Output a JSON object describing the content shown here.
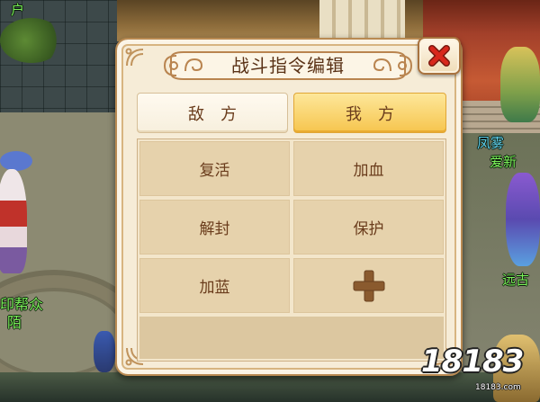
{
  "dialog": {
    "title": "战斗指令编辑",
    "close_icon": "close-icon",
    "tabs": [
      {
        "label": "敌方",
        "selected": false
      },
      {
        "label": "我方",
        "selected": true
      }
    ],
    "commands": [
      {
        "label": "复活"
      },
      {
        "label": "加血"
      },
      {
        "label": "解封"
      },
      {
        "label": "保护"
      },
      {
        "label": "加蓝"
      }
    ],
    "add_command_icon": "plus-icon"
  },
  "scene": {
    "name_tags": [
      {
        "text": "户",
        "color": "#7cf05a"
      },
      {
        "text": "印帮众",
        "color": "#7cf05a"
      },
      {
        "text": "陌",
        "color": "#7cf05a"
      },
      {
        "text": "凤雾",
        "color": "#5fd0ef"
      },
      {
        "text": "爱新",
        "color": "#7cf05a"
      },
      {
        "text": "远古",
        "color": "#7cf05a"
      }
    ]
  },
  "watermark": {
    "logo": "18183",
    "site": "18183.com"
  },
  "colors": {
    "panel": "#f6ecd7",
    "selected_tab": "#f6c54e",
    "unselected_tab": "#f7efdd",
    "command_cell": "#e6d2ac",
    "text_brown": "#6a3c1c",
    "close_red": "#d8281c",
    "plus_brown": "#8a5a2e"
  }
}
